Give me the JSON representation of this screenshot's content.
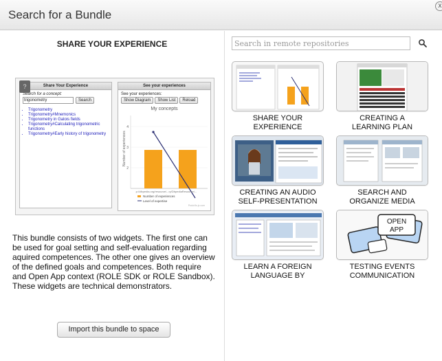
{
  "window": {
    "title": "Search for a Bundle",
    "close_glyph": "x"
  },
  "bundle": {
    "title": "SHARE YOUR EXPERIENCE",
    "description": "This bundle consists of two widgets. The first one can be used for goal setting and self-evaluation regarding aquired competences. The other one gives an overview of the defined goals and competences. Both require and Open App context (ROLE SDK or ROLE Sandbox). These widgets are technical demonstrators.",
    "import_label": "Import this bundle to space",
    "preview": {
      "widget1": {
        "title": "Share Your Experience",
        "search_label": "Search for a concept:",
        "search_value": "trigonometry",
        "search_button": "Search",
        "results": [
          "Trigonometry",
          "Trigonometry#Mnemonics",
          "Trigonometry in Galois fields",
          "Trigonometry#Calculating trigonometric functions",
          "Trigonometry#Early history of trigonometry"
        ]
      },
      "widget2": {
        "title": "See your experiences",
        "label": "See your experiences:",
        "buttons": [
          "Show Diagram",
          "Show List",
          "Reload"
        ],
        "chart_title": "My concepts",
        "y_axis_label": "Number of experiences",
        "x_tick_label": "p://dbpedia.org/resource/...ry/DbpediaResource/...",
        "legend": [
          "Number of experiences",
          "Level of expertise"
        ],
        "watermark": "ProtoVis.js com",
        "bar_color": "#f5a21c",
        "line_color": "#2b2f73"
      }
    }
  },
  "repository_search": {
    "placeholder": "Search in remote repositories",
    "value": ""
  },
  "bundles": [
    {
      "label_lines": [
        "SHARE YOUR",
        "EXPERIENCE"
      ],
      "thumb": "share-experience"
    },
    {
      "label_lines": [
        "CREATING A",
        "LEARNING PLAN"
      ],
      "thumb": "learning-plan"
    },
    {
      "label_lines": [
        "CREATING AN AUDIO",
        "SELF-PRESENTATION"
      ],
      "thumb": "audio-presentation"
    },
    {
      "label_lines": [
        "SEARCH AND",
        "ORGANIZE MEDIA"
      ],
      "thumb": "organize-media"
    },
    {
      "label_lines": [
        "LEARN A FOREIGN",
        "LANGUAGE BY"
      ],
      "thumb": "foreign-language"
    },
    {
      "label_lines": [
        "TESTING EVENTS",
        "COMMUNICATION"
      ],
      "thumb": "testing-events",
      "thumb_text": [
        "OPEN",
        "APP"
      ]
    }
  ]
}
